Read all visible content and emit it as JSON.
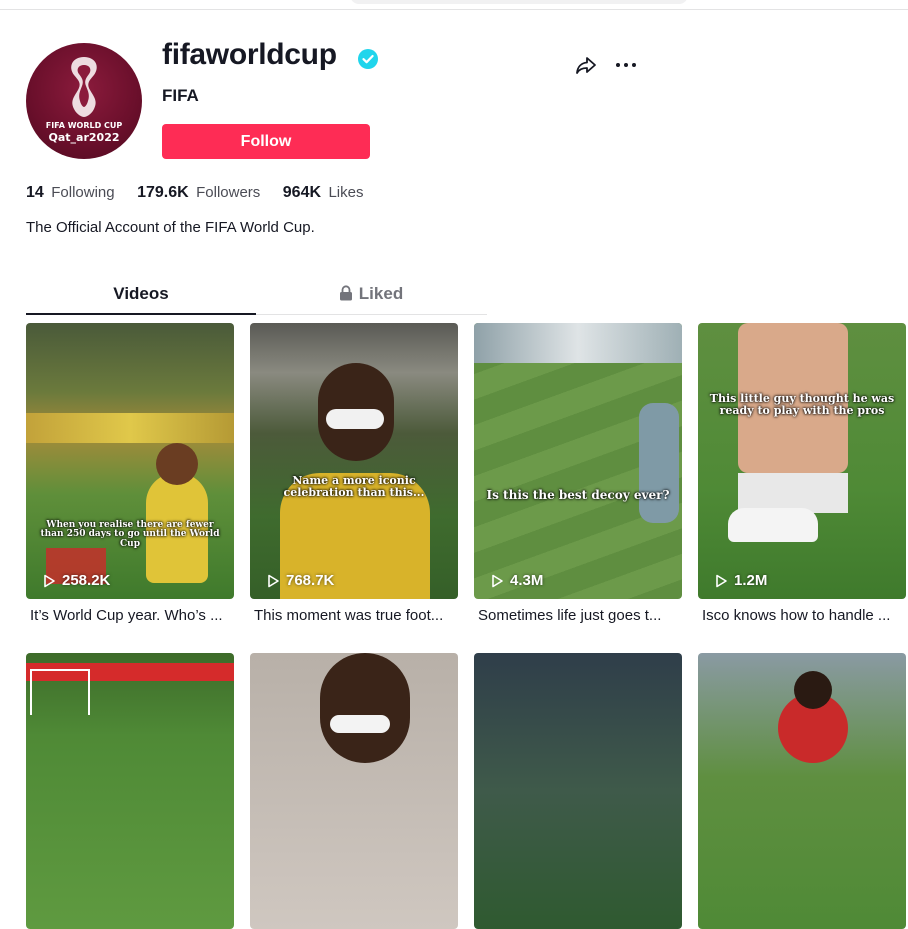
{
  "profile": {
    "username": "fifaworldcup",
    "display_name": "FIFA",
    "follow_label": "Follow",
    "bio": "The Official Account of the FIFA World Cup.",
    "avatar": {
      "line1": "FIFA WORLD CUP",
      "line2": "Qat_ar2022"
    },
    "verified_color": "#20d5ec",
    "accent_color": "#fe2c55"
  },
  "stats": [
    {
      "value": "14",
      "label": "Following"
    },
    {
      "value": "179.6K",
      "label": "Followers"
    },
    {
      "value": "964K",
      "label": "Likes"
    }
  ],
  "tabs": [
    {
      "label": "Videos",
      "active": true
    },
    {
      "label": "Liked",
      "icon": "lock-icon",
      "active": false
    }
  ],
  "videos": [
    {
      "views": "258.2K",
      "title": "It’s World Cup year. Who’s ...",
      "overlay": "When you realise there are fewer than 250 days to go until the World Cup"
    },
    {
      "views": "768.7K",
      "title": "This moment was true foot...",
      "overlay": "Name a more iconic celebration than this..."
    },
    {
      "views": "4.3M",
      "title": "Sometimes life just goes t...",
      "overlay": "Is this the best decoy ever?"
    },
    {
      "views": "1.2M",
      "title": "Isco knows how to handle ...",
      "overlay": "This little guy thought he was ready to play with the pros"
    },
    {
      "views": "",
      "title": "",
      "overlay": ""
    },
    {
      "views": "",
      "title": "",
      "overlay": ""
    },
    {
      "views": "",
      "title": "",
      "overlay": ""
    },
    {
      "views": "",
      "title": "",
      "overlay": ""
    }
  ]
}
